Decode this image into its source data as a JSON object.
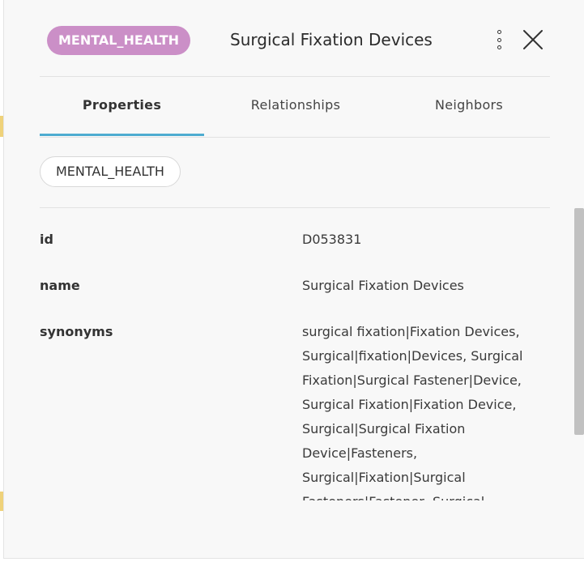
{
  "node": {
    "label": "MENTAL_HEALTH",
    "title": "Surgical Fixation Devices",
    "label_color": "#cb8fc7"
  },
  "icons": {
    "menu": "kebab-vertical-icon",
    "close": "close-x-icon"
  },
  "tabs": [
    {
      "label": "Properties",
      "active": true
    },
    {
      "label": "Relationships",
      "active": false
    },
    {
      "label": "Neighbors",
      "active": false
    }
  ],
  "accent_color": "#4eacd0",
  "chip": "MENTAL_HEALTH",
  "properties": [
    {
      "key": "id",
      "value": "D053831"
    },
    {
      "key": "name",
      "value": "Surgical Fixation Devices"
    },
    {
      "key": "synonyms",
      "value": "surgical fixation|Fixation Devices, Surgical|fixation|Devices, Surgical Fixation|Surgical Fastener|Device, Surgical Fixation|Fixation Device, Surgical|Surgical Fixation Device|Fasteners, Surgical|Fixation|Surgical Fasteners|Fastener, Surgical"
    }
  ]
}
